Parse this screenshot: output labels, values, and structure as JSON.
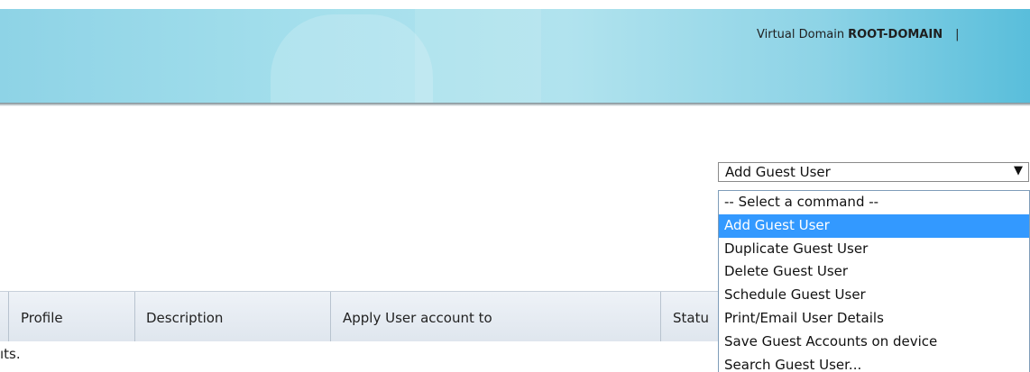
{
  "header": {
    "vdomain_label": "Virtual Domain",
    "vdomain_value": "ROOT-DOMAIN",
    "separator": "|"
  },
  "command": {
    "selected": "Add Guest User",
    "options": [
      "-- Select a command --",
      "Add Guest User",
      "Duplicate Guest User",
      "Delete Guest User",
      "Schedule Guest User",
      "Print/Email User Details",
      "Save Guest Accounts on device",
      "Search Guest User..."
    ],
    "highlighted_index": 1
  },
  "table": {
    "columns": [
      "Profile",
      "Description",
      "Apply User account to",
      "Statu"
    ]
  },
  "footer": {
    "truncated_text": "ıts."
  },
  "colors": {
    "highlight": "#3399ff",
    "banner": "#a4dfec"
  }
}
